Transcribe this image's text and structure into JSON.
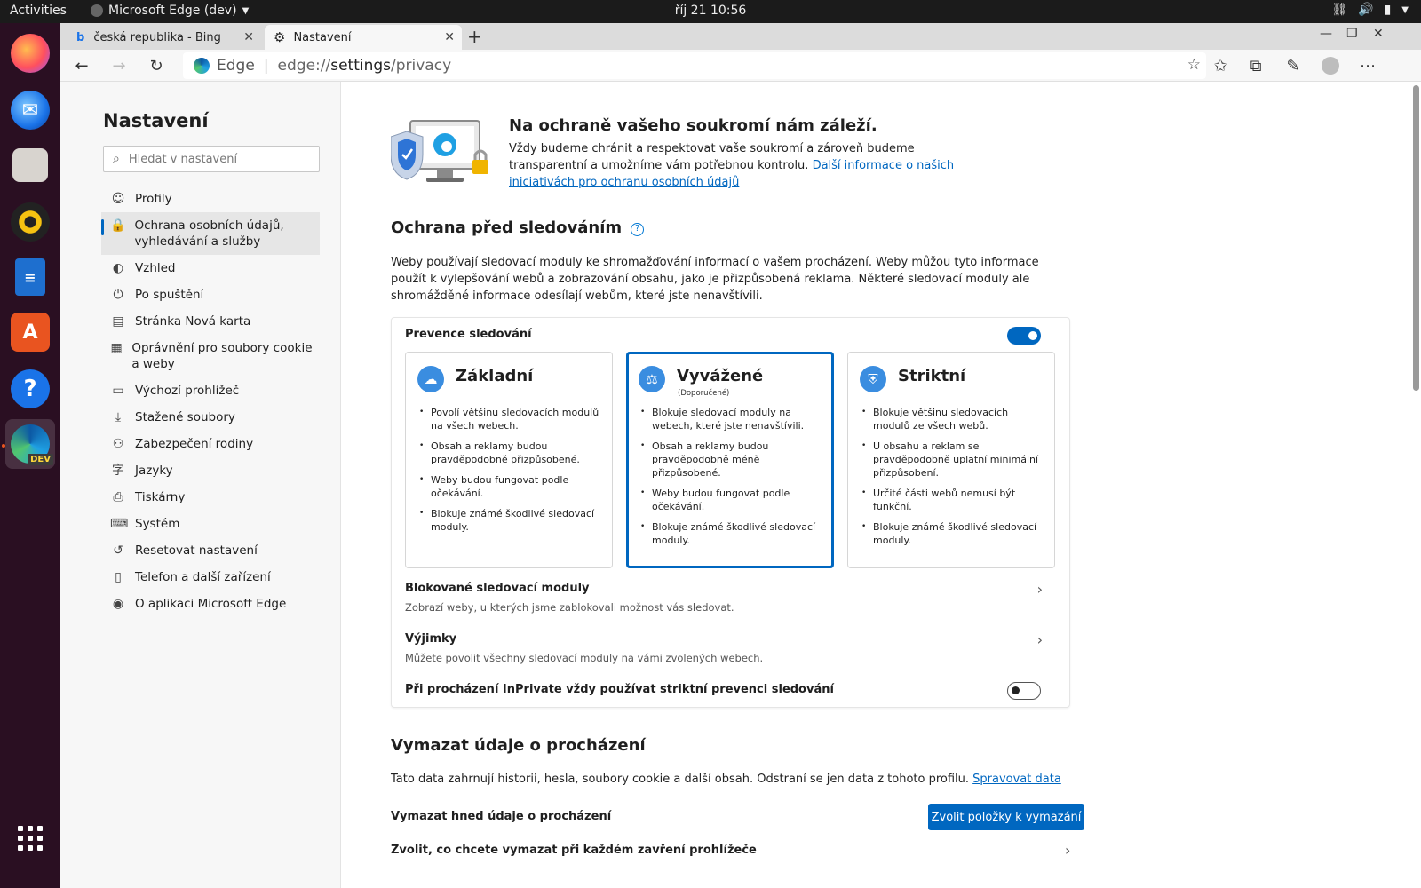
{
  "topbar": {
    "activities": "Activities",
    "app_name": "Microsoft Edge (dev)",
    "clock": "říj 21  10:56"
  },
  "dock": {
    "items": [
      "firefox-icon",
      "thunderbird-icon",
      "files-icon",
      "rhythmbox-icon",
      "libreoffice-writer-icon",
      "app-center-icon",
      "help-icon",
      "edge-dev-icon",
      "show-apps-icon"
    ],
    "edge_badge": "DEV"
  },
  "tabs": [
    {
      "label": "česká republika - Bing",
      "icon": "bing-icon"
    },
    {
      "label": "Nastavení",
      "icon": "gear-icon"
    }
  ],
  "address": {
    "site_label": "Edge",
    "url_prefix": "edge://",
    "url_path": "settings",
    "url_suffix": "/privacy"
  },
  "sidebar": {
    "title": "Nastavení",
    "search_placeholder": "Hledat v nastavení",
    "items": [
      {
        "label": "Profily",
        "icon": "profile-icon"
      },
      {
        "label": "Ochrana osobních údajů, vyhledávání a služby",
        "icon": "lock-icon"
      },
      {
        "label": "Vzhled",
        "icon": "palette-icon"
      },
      {
        "label": "Po spuštění",
        "icon": "power-icon"
      },
      {
        "label": "Stránka Nová karta",
        "icon": "newtab-page-icon"
      },
      {
        "label": "Oprávnění pro soubory cookie a weby",
        "icon": "site-permissions-icon"
      },
      {
        "label": "Výchozí prohlížeč",
        "icon": "browser-icon"
      },
      {
        "label": "Stažené soubory",
        "icon": "download-icon"
      },
      {
        "label": "Zabezpečení rodiny",
        "icon": "family-icon"
      },
      {
        "label": "Jazyky",
        "icon": "languages-icon"
      },
      {
        "label": "Tiskárny",
        "icon": "printer-icon"
      },
      {
        "label": "Systém",
        "icon": "laptop-icon"
      },
      {
        "label": "Resetovat nastavení",
        "icon": "reset-icon"
      },
      {
        "label": "Telefon a další zařízení",
        "icon": "phone-icon"
      },
      {
        "label": "O aplikaci Microsoft Edge",
        "icon": "edge-icon"
      }
    ]
  },
  "hero": {
    "title": "Na ochraně vašeho soukromí nám záleží.",
    "text": "Vždy budeme chránit a respektovat vaše soukromí a zároveň budeme transparentní a umožníme vám potřebnou kontrolu. ",
    "link": "Další informace o našich iniciativách pro ochranu osobních údajů"
  },
  "tracking": {
    "title": "Ochrana před sledováním",
    "description": "Weby používají sledovací moduly ke shromažďování informací o vašem procházení. Weby můžou tyto informace použít k vylepšování webů a zobrazování obsahu, jako je přizpůsobená reklama. Některé sledovací moduly ale shromážděné informace odesílají webům, které jste nenavštívili.",
    "prevention_label": "Prevence sledování",
    "prevention_on": true,
    "levels": [
      {
        "name": "Základní",
        "subtitle": "",
        "bullets": [
          "Povolí většinu sledovacích modulů na všech webech.",
          "Obsah a reklamy budou pravděpodobně přizpůsobené.",
          "Weby budou fungovat podle očekávání.",
          "Blokuje známé škodlivé sledovací moduly."
        ]
      },
      {
        "name": "Vyvážené",
        "subtitle": "(Doporučené)",
        "bullets": [
          "Blokuje sledovací moduly na webech, které jste nenavštívili.",
          "Obsah a reklamy budou pravděpodobně méně přizpůsobené.",
          "Weby budou fungovat podle očekávání.",
          "Blokuje známé škodlivé sledovací moduly."
        ]
      },
      {
        "name": "Striktní",
        "subtitle": "",
        "bullets": [
          "Blokuje většinu sledovacích modulů ze všech webů.",
          "U obsahu a reklam se pravděpodobně uplatní minimální přizpůsobení.",
          "Určité části webů nemusí být funkční.",
          "Blokuje známé škodlivé sledovací moduly."
        ]
      }
    ],
    "selected_level": "Vyvážené",
    "blocked_title": "Blokované sledovací moduly",
    "blocked_sub": "Zobrazí weby, u kterých jsme zablokovali možnost vás sledovat.",
    "exceptions_title": "Výjimky",
    "exceptions_sub": "Můžete povolit všechny sledovací moduly na vámi zvolených webech.",
    "inprivate_label": "Při procházení InPrivate vždy používat striktní prevenci sledování",
    "inprivate_on": false
  },
  "clear": {
    "title": "Vymazat údaje o procházení",
    "description": "Tato data zahrnují historii, hesla, soubory cookie a další obsah. Odstraní se jen data z tohoto profilu. ",
    "manage_link": "Spravovat data",
    "clear_now_label": "Vymazat hned údaje o procházení",
    "choose_button": "Zvolit položky k vymazání",
    "on_close_label": "Zvolit, co chcete vymazat při každém zavření prohlížeče"
  },
  "colors": {
    "accent": "#0067c0",
    "dock_bg": "#2a0f22",
    "topbar_bg": "#1b1b1b"
  }
}
